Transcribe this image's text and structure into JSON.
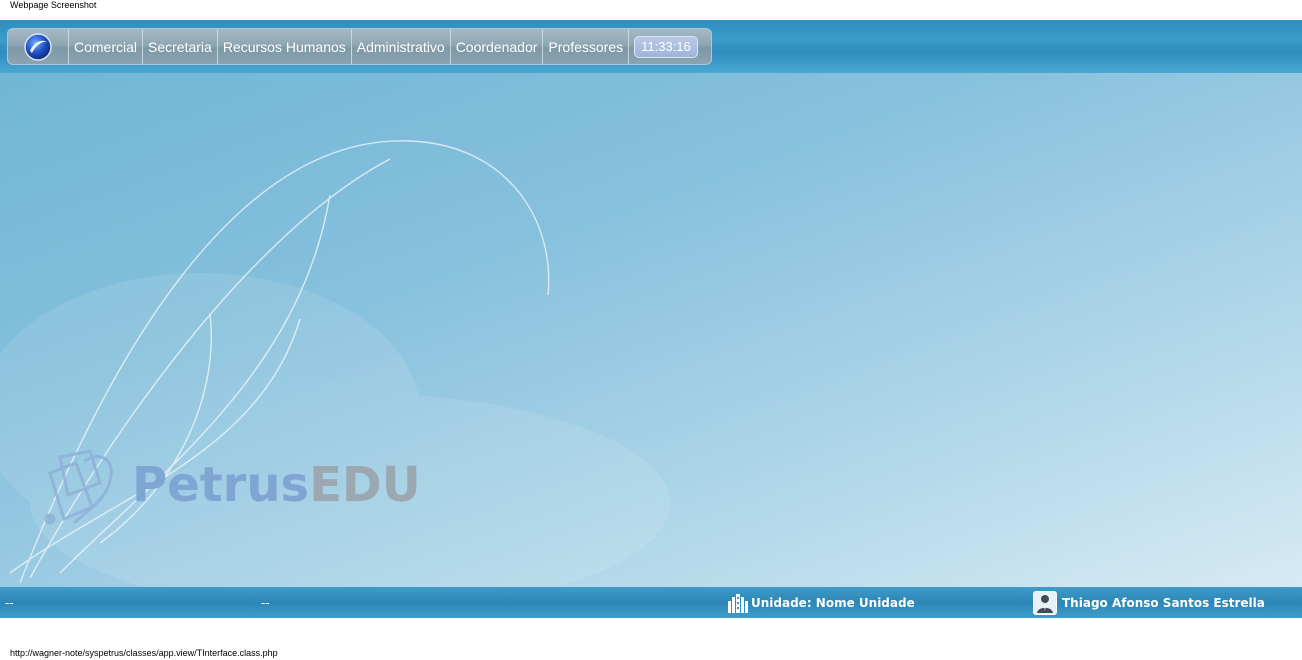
{
  "page_caption": "Webpage Screenshot",
  "menu": {
    "items": [
      {
        "label": "Comercial"
      },
      {
        "label": "Secretaria"
      },
      {
        "label": "Recursos Humanos"
      },
      {
        "label": "Administrativo"
      },
      {
        "label": "Coordenador"
      },
      {
        "label": "Professores"
      }
    ],
    "clock": "11:33:16"
  },
  "brand": {
    "part1": "Petrus",
    "part2": "EDU"
  },
  "footer": {
    "status_left": "--",
    "status_mid": "--",
    "unit_label": "Unidade: Nome Unidade",
    "user_name": "Thiago Afonso Santos Estrella"
  },
  "status_url": "http://wagner-note/syspetrus/classes/app.view/TInterface.class.php",
  "colors": {
    "bar_blue": "#2f8fbe",
    "menu_gray": "#8fa7b3",
    "brand_blue": "#7fa6d3",
    "brand_gray": "#9ba8b2"
  },
  "icons": {
    "menu_logo": "app-logo-icon",
    "unit": "building-icon",
    "user": "user-avatar-icon",
    "brand": "petrus-logo-icon"
  }
}
